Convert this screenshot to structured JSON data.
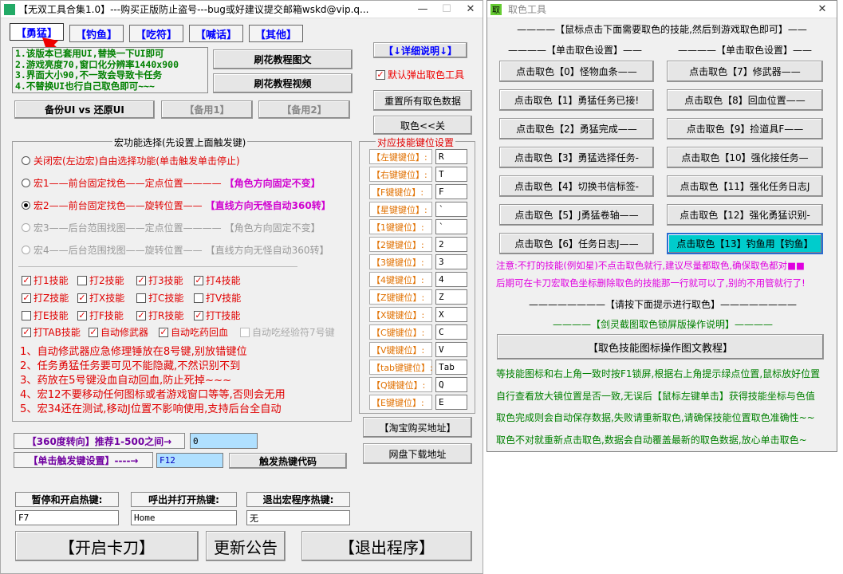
{
  "main": {
    "title": "【无双工具合集1.0】---购买正版防止盗号---bug或好建议提交邮箱wskd@vip.q...",
    "tabs": [
      "【勇猛】",
      "【钓鱼】",
      "【吃符】",
      "【喊话】",
      "【其他】"
    ],
    "info_lines": [
      "1.该版本已套用UI,替换一下UI即可",
      "2.游戏亮度70,窗口化分辨率1440x900",
      "3.界面大小90,不一致会导致卡任务",
      "4.不替换UI也行自己取色即可~~~"
    ],
    "btn_guide_img": "刷花教程图文",
    "btn_guide_video": "刷花教程视频",
    "btn_detail": "【↓详细说明↓】",
    "cb_auto_popup": "默认弹出取色工具",
    "btn_reset": "重置所有取色数据",
    "btn_color_toggle": "取色<<关",
    "btn_backup_ui": "备份UI vs 还原UI",
    "btn_spare1": "【备用1】",
    "btn_spare2": "【备用2】",
    "macro_group_title": "宏功能选择(先设置上面触发键)",
    "macros": [
      {
        "left": "关闭宏(左边宏)自由选择功能(单击触发单击停止)",
        "right": "",
        "checked": false,
        "disabled": false
      },
      {
        "left": "宏1——前台固定找色——定点位置————",
        "right": "【角色方向固定不变】",
        "checked": false,
        "disabled": false
      },
      {
        "left": "宏2——前台固定找色——旋转位置——",
        "right": "【直线方向无怪自动360转】",
        "checked": true,
        "disabled": false
      },
      {
        "left": "宏3——后台范围找图——定点位置————",
        "right": "【角色方向固定不变】",
        "checked": false,
        "disabled": true
      },
      {
        "left": "宏4——后台范围找图——旋转位置——",
        "right": "【直线方向无怪自动360转】",
        "checked": false,
        "disabled": true
      }
    ],
    "skills": [
      [
        {
          "l": "打1技能",
          "c": true
        },
        {
          "l": "打2技能",
          "c": false
        },
        {
          "l": "打3技能",
          "c": true
        },
        {
          "l": "打4技能",
          "c": true
        }
      ],
      [
        {
          "l": "打Z技能",
          "c": true
        },
        {
          "l": "打X技能",
          "c": true
        },
        {
          "l": "打C技能",
          "c": false
        },
        {
          "l": "打V技能",
          "c": false
        }
      ],
      [
        {
          "l": "打E技能",
          "c": false
        },
        {
          "l": "打F技能",
          "c": true
        },
        {
          "l": "打R技能",
          "c": true
        },
        {
          "l": "打T技能",
          "c": true
        }
      ]
    ],
    "extra_checks": [
      {
        "l": "打TAB技能",
        "c": true,
        "d": false
      },
      {
        "l": "自动修武器",
        "c": true,
        "d": false
      },
      {
        "l": "自动吃药回血",
        "c": true,
        "d": false
      },
      {
        "l": "自动吃经验符7号键",
        "c": false,
        "d": true
      }
    ],
    "notes": [
      "1、自动修武器应急修理锤放在8号键,别放错键位",
      "2、任务勇猛任务要可见不能隐藏,不然识别不到",
      "3、药放在5号键没血自动回血,防止死掉~~~",
      "4、宏12不要移动任何图标或者游戏窗口等等,否则会无用",
      "5、宏34还在测试,移动J位置不影响使用,支持后台全自动"
    ],
    "key_group_title": "对应技能键位设置",
    "keys": [
      {
        "l": "【左键键位】:",
        "v": "R"
      },
      {
        "l": "【右键键位】:",
        "v": "T"
      },
      {
        "l": "【F键键位】:",
        "v": "F"
      },
      {
        "l": "【星键键位】:",
        "v": "`"
      },
      {
        "l": "【1键键位】:",
        "v": "`"
      },
      {
        "l": "【2键键位】:",
        "v": "2"
      },
      {
        "l": "【3键键位】:",
        "v": "3"
      },
      {
        "l": "【4键键位】:",
        "v": "4"
      },
      {
        "l": "【Z键键位】:",
        "v": "Z"
      },
      {
        "l": "【X键键位】:",
        "v": "X"
      },
      {
        "l": "【C键键位】:",
        "v": "C"
      },
      {
        "l": "【V键键位】:",
        "v": "V"
      },
      {
        "l": "【tab键键位】:",
        "v": "Tab"
      },
      {
        "l": "【Q键键位】:",
        "v": "Q"
      },
      {
        "l": "【E键键位】:",
        "v": "E"
      }
    ],
    "btn_taobao": "【淘宝购买地址】",
    "btn_download": "网盘下载地址",
    "turn_label": "【360度转向】推荐1-500之间→",
    "turn_value": "0",
    "trigger_label": "【单击触发键设置】----→",
    "trigger_value": "F12",
    "btn_trigger_code": "触发热键代码",
    "hk_pause_label": "暂停和开启热键:",
    "hk_pause_value": "F7",
    "hk_open_label": "呼出并打开热键:",
    "hk_open_value": "Home",
    "hk_exit_label": "退出宏程序热键:",
    "hk_exit_value": "无",
    "btn_start": "【开启卡刀】",
    "btn_update": "更新公告",
    "btn_exit": "【退出程序】"
  },
  "picker": {
    "title": "取色工具",
    "icon_text": "取",
    "header": "【鼠标点击下面需要取色的技能,然后到游戏取色即可】",
    "left_title": "【单击取色设置】",
    "right_title": "【单击取色设置】",
    "left_buttons": [
      "点击取色【0】怪物血条——",
      "点击取色【1】勇猛任务已接!",
      "点击取色【2】勇猛完成——",
      "点击取色【3】勇猛选择任务-",
      "点击取色【4】切换书信标签-",
      "点击取色【5】J勇猛卷轴——",
      "点击取色【6】任务日志J——"
    ],
    "right_buttons": [
      "点击取色【7】修武器——",
      "点击取色【8】回血位置——",
      "点击取色【9】捡道具F——",
      "点击取色【10】强化接任务—",
      "点击取色【11】强化任务日志J",
      "点击取色【12】强化勇猛识别-",
      "点击取色【13】钓鱼用【钓鱼】"
    ],
    "note1": "注意:不打的技能(例如星)不点击取色就行,建议尽量都取色,确保取色都对",
    "note2": "后期可在卡刀宏取色坐标删除取色的技能那一行就可以了,别的不用管就行了!",
    "prompt_header": "【请按下面提示进行取色】",
    "green_title": "【剑灵截图取色锁屏版操作说明】",
    "btn_tutorial": "【取色技能图标操作图文教程】",
    "instructions": [
      "等技能图标和右上角一致时按F1锁屏,根据右上角提示绿点位置,鼠标放好位置",
      "自行查看放大镜位置是否一致,无误后【鼠标左键单击】获得技能坐标与色值",
      "取色完成则会自动保存数据,失败请重新取色,请确保技能位置取色准确性~~",
      "取色不对就重新点击取色,数据会自动覆盖最新的取色数据,放心单击取色~"
    ],
    "colors": {
      "accent": "#00cccc",
      "blue": "#0000ff",
      "green": "#008000",
      "magenta": "#e000e0"
    }
  }
}
